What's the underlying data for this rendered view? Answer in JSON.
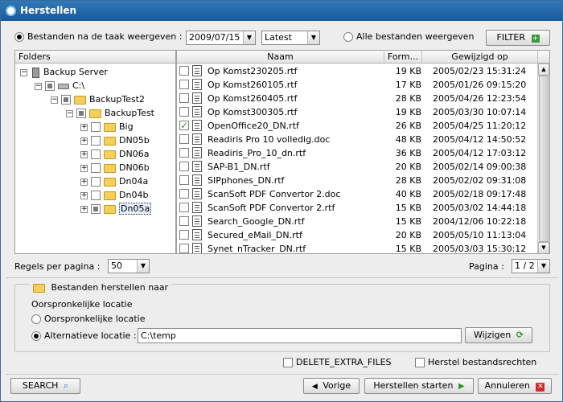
{
  "window": {
    "title": "Herstellen",
    "close_glyph": "✕"
  },
  "filter_bar": {
    "radio_task_label": "Bestanden na de taak weergeven :",
    "date_value": "2009/07/15",
    "version_value": "Latest",
    "radio_all_label": "Alle bestanden weergeven",
    "filter_button": "FILTER"
  },
  "tree": {
    "header": "Folders",
    "nodes": [
      {
        "label": "Backup Server",
        "exp": "⊟",
        "type": "server"
      },
      {
        "label": "C:\\",
        "exp": "⊟",
        "type": "drive"
      },
      {
        "label": "BackupTest2",
        "exp": "⊟",
        "type": "folder"
      },
      {
        "label": "BackupTest",
        "exp": "⊟",
        "type": "folder"
      },
      {
        "label": "Big",
        "exp": "+",
        "type": "folder"
      },
      {
        "label": "DN05b",
        "exp": "+",
        "type": "folder"
      },
      {
        "label": "DN06a",
        "exp": "+",
        "type": "folder"
      },
      {
        "label": "DN06b",
        "exp": "+",
        "type": "folder"
      },
      {
        "label": "Dn04a",
        "exp": "+",
        "type": "folder"
      },
      {
        "label": "Dn04b",
        "exp": "+",
        "type": "folder"
      },
      {
        "label": "Dn05a",
        "exp": "+",
        "type": "folder"
      }
    ]
  },
  "files": {
    "columns": {
      "name": "Naam",
      "format": "Form...",
      "modified": "Gewijzigd op"
    },
    "rows": [
      {
        "name": "Op Komst230205.rtf",
        "size": "19 KB",
        "date": "2005/02/23 15:31:24",
        "checked": false
      },
      {
        "name": "Op Komst260105.rtf",
        "size": "17 KB",
        "date": "2005/01/26 09:15:20",
        "checked": false
      },
      {
        "name": "Op Komst260405.rtf",
        "size": "28 KB",
        "date": "2005/04/26 12:23:54",
        "checked": false
      },
      {
        "name": "Op Komst300305.rtf",
        "size": "19 KB",
        "date": "2005/03/30 10:07:14",
        "checked": false
      },
      {
        "name": "OpenOffice20_DN.rtf",
        "size": "26 KB",
        "date": "2005/04/25 11:20:12",
        "checked": true
      },
      {
        "name": "Readiris Pro 10 volledig.doc",
        "size": "48 KB",
        "date": "2005/04/12 14:50:52",
        "checked": false
      },
      {
        "name": "Readiris_Pro_10_dn.rtf",
        "size": "36 KB",
        "date": "2005/04/12 17:03:12",
        "checked": false
      },
      {
        "name": "SAP-B1_DN.rtf",
        "size": "20 KB",
        "date": "2005/02/14 09:00:38",
        "checked": false
      },
      {
        "name": "SIPphones_DN.rtf",
        "size": "28 KB",
        "date": "2005/02/02 09:31:08",
        "checked": false
      },
      {
        "name": "ScanSoft PDF Convertor 2.doc",
        "size": "40 KB",
        "date": "2005/02/18 09:17:48",
        "checked": false
      },
      {
        "name": "ScanSoft PDF Convertor 2.rtf",
        "size": "15 KB",
        "date": "2005/03/02 14:44:18",
        "checked": false
      },
      {
        "name": "Search_Google_DN.rtf",
        "size": "15 KB",
        "date": "2004/12/06 10:22:18",
        "checked": false
      },
      {
        "name": "Secured_eMail_DN.rtf",
        "size": "20 KB",
        "date": "2005/05/10 11:13:04",
        "checked": false
      },
      {
        "name": "Synet_nTracker_DN.rtf",
        "size": "15 KB",
        "date": "2005/03/03 15:30:12",
        "checked": false
      }
    ]
  },
  "pager": {
    "rows_label": "Regels per pagina :",
    "rows_value": "50",
    "page_label": "Pagina :",
    "page_value": "1 / 2"
  },
  "restore": {
    "group_title": "Bestanden herstellen naar",
    "original_location_caption": "Oorspronkelijke locatie",
    "radio_original_label": "Oorspronkelijke locatie",
    "radio_alternative_label": "Alternatieve locatie :",
    "alternative_path": "C:\\temp",
    "change_button": "Wijzigen"
  },
  "options": {
    "delete_extra": "DELETE_EXTRA_FILES",
    "restore_rights": "Herstel bestandsrechten"
  },
  "footer": {
    "search_button": "SEARCH",
    "prev_button": "Vorige",
    "start_button": "Herstellen starten",
    "cancel_button": "Annuleren"
  },
  "colors": {
    "title_bar": "#1b5a99",
    "start_arrow": "#2a9a2a",
    "cancel_x": "#d22b2b"
  }
}
